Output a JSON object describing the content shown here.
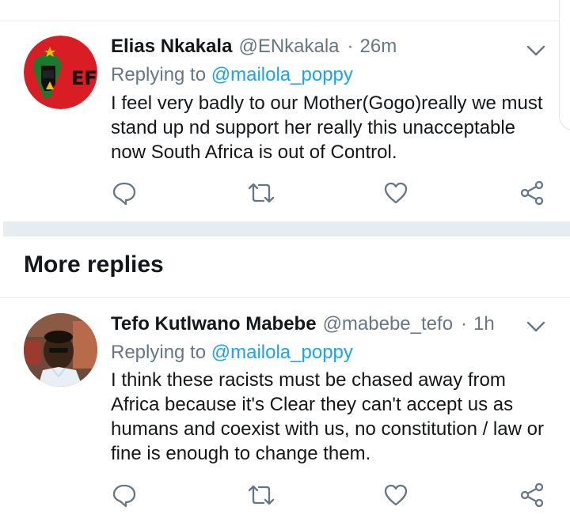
{
  "tweets": [
    {
      "name": "Elias Nkakala",
      "handle": "@ENkakala",
      "separator": "·",
      "time": "26m",
      "replying_prefix": "Replying to",
      "replying_to": "@mailola_poppy",
      "text": "I feel very badly to our Mother(Gogo)really we must stand up nd support her really this unacceptable now South Africa is out of Control.",
      "avatar_logo_text": "EF"
    },
    {
      "name": "Tefo Kutlwano Mabebe",
      "handle": "@mabebe_tefo",
      "separator": "·",
      "time": "1h",
      "replying_prefix": "Replying to",
      "replying_to": "@mailola_poppy",
      "text": "I think these racists must be chased away from Africa because it's Clear they can't accept us as humans and coexist with us, no constitution / law or fine is enough to change them."
    }
  ],
  "section": {
    "more_replies": "More replies"
  },
  "icons": {
    "menu": "chevron-down-icon",
    "reply": "reply-icon",
    "retweet": "retweet-icon",
    "like": "heart-icon",
    "share": "share-icon"
  },
  "colors": {
    "text": "#14171a",
    "secondary": "#657786",
    "link": "#1da1f2",
    "separator": "#e6ecf0"
  }
}
